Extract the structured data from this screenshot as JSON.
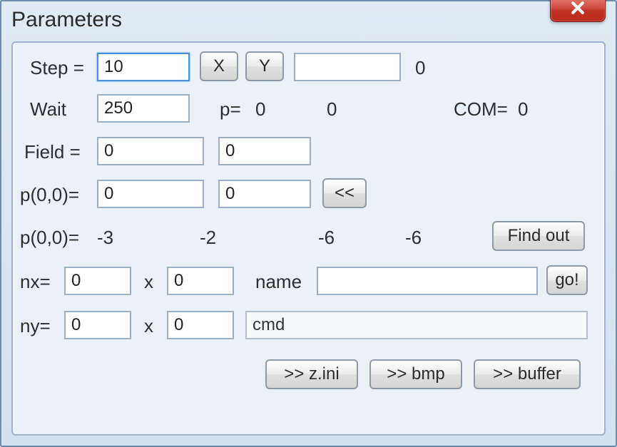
{
  "window": {
    "title": "Parameters"
  },
  "row_step": {
    "label": "Step =",
    "value": "10",
    "btn_x": "X",
    "btn_y": "Y",
    "coord": "",
    "coord_readout": "0"
  },
  "row_wait": {
    "label": "Wait",
    "value": "250",
    "p_label": "p=",
    "p_val1": "0",
    "p_val2": "0",
    "com_label": "COM=",
    "com_val": "0"
  },
  "row_field": {
    "label": "Field =",
    "val1": "0",
    "val2": "0"
  },
  "row_p00": {
    "label": "p(0,0)=",
    "val1": "0",
    "val2": "0",
    "back_btn": "<<"
  },
  "row_p00b": {
    "label": "p(0,0)=",
    "v1": "-3",
    "v2": "-2",
    "v3": "-6",
    "v4": "-6",
    "findout_btn": "Find out"
  },
  "row_nx": {
    "label": "nx=",
    "v1": "0",
    "x_sep": "x",
    "v2": "0",
    "name_label": "name",
    "name_value": "",
    "go_btn": "go!"
  },
  "row_ny": {
    "label": "ny=",
    "v1": "0",
    "x_sep": "x",
    "v2": "0",
    "cmd_value": "cmd"
  },
  "bottom": {
    "zini": ">> z.ini",
    "bmp": ">> bmp",
    "buffer": ">> buffer"
  }
}
